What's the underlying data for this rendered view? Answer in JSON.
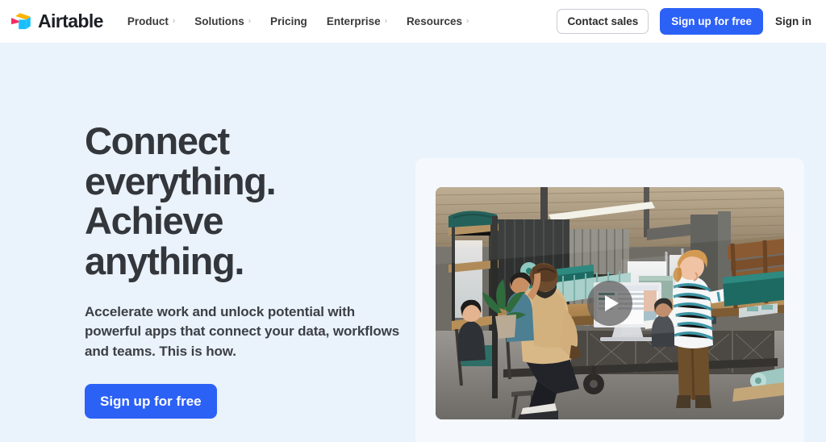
{
  "header": {
    "brand": {
      "name": "Airtable",
      "logo_icon": "airtable-cube-icon",
      "colors": {
        "yellow": "#fcb400",
        "blue": "#18bfff",
        "red": "#f82b60"
      }
    },
    "nav": [
      {
        "label": "Product",
        "has_chevron": true,
        "chevron": "›"
      },
      {
        "label": "Solutions",
        "has_chevron": true,
        "chevron": "›"
      },
      {
        "label": "Pricing",
        "has_chevron": false,
        "chevron": ""
      },
      {
        "label": "Enterprise",
        "has_chevron": true,
        "chevron": "›"
      },
      {
        "label": "Resources",
        "has_chevron": true,
        "chevron": "›"
      }
    ],
    "actions": {
      "contact_sales_label": "Contact sales",
      "signup_label": "Sign up for free",
      "signin_label": "Sign in"
    }
  },
  "hero": {
    "headline_lines": [
      "Connect",
      "everything.",
      "Achieve",
      "anything."
    ],
    "headline_full": "Connect everything. Achieve anything.",
    "subhead": "Accelerate work and unlock potential with powerful apps that connect your data, workflows and teams. This is how.",
    "cta_label": "Sign up for free",
    "media": {
      "alt": "Team collaborating in an industrial workshop around a long wooden table with a laptop showing an Airtable base",
      "play_icon": "play-icon",
      "is_video": true
    }
  },
  "colors": {
    "page_background": "#eaf2fb",
    "card_background": "#f5f8fd",
    "header_background": "#ffffff",
    "accent_blue": "#2c61f6",
    "heading_text": "#33363b",
    "body_text": "#3c3f45"
  }
}
